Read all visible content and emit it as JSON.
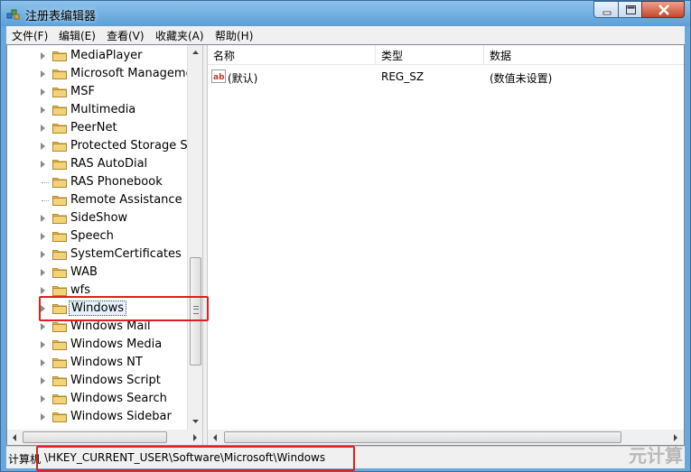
{
  "window": {
    "title": "注册表编辑器",
    "icon": "regedit-icon",
    "controls": {
      "minimize": "minimize-icon",
      "maximize": "maximize-icon",
      "close": "close-icon"
    }
  },
  "menu": [
    "文件(F)",
    "编辑(E)",
    "查看(V)",
    "收藏夹(A)",
    "帮助(H)"
  ],
  "tree": {
    "items": [
      "MediaPlayer",
      "Microsoft Manageme",
      "MSF",
      "Multimedia",
      "PeerNet",
      "Protected Storage Sys",
      "RAS AutoDial",
      "RAS Phonebook",
      "Remote Assistance",
      "SideShow",
      "Speech",
      "SystemCertificates",
      "WAB",
      "wfs",
      "Windows",
      "Windows Mail",
      "Windows Media",
      "Windows NT",
      "Windows Script",
      "Windows Search",
      "Windows Sidebar"
    ],
    "selected": "Windows"
  },
  "list": {
    "columns": [
      "名称",
      "类型",
      "数据"
    ],
    "rows": [
      {
        "name": "(默认)",
        "type": "REG_SZ",
        "data": "(数值未设置)"
      }
    ]
  },
  "status": {
    "prefix": "计算机",
    "path": "\\HKEY_CURRENT_USER\\Software\\Microsoft\\Windows"
  },
  "watermark": "元计算",
  "colors": {
    "highlight": "#e02020",
    "title_bar": "#6aa8dc",
    "folder": "#e8c05a"
  }
}
